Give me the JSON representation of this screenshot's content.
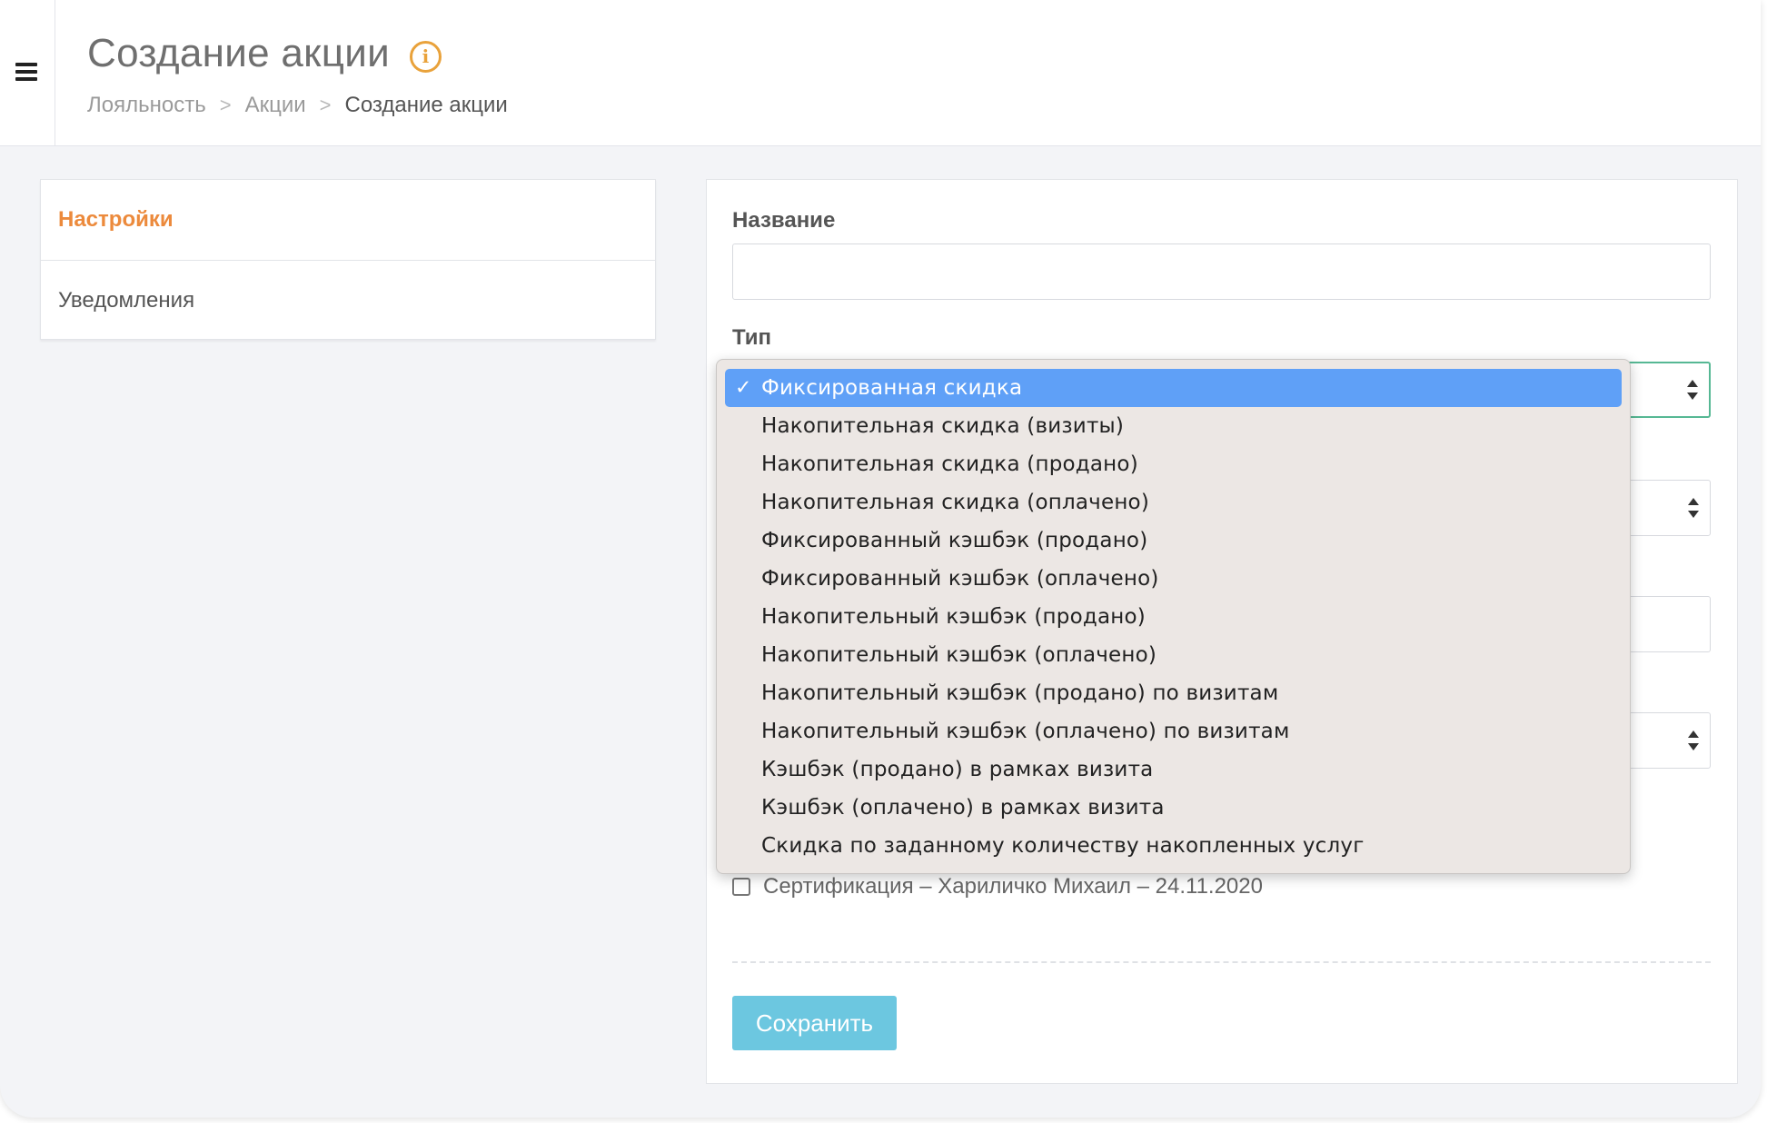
{
  "header": {
    "title": "Создание акции",
    "breadcrumb": [
      "Лояльность",
      "Акции",
      "Создание акции"
    ],
    "separator": ">"
  },
  "tabs": [
    {
      "label": "Настройки",
      "active": true
    },
    {
      "label": "Уведомления",
      "active": false
    }
  ],
  "form": {
    "name_label": "Название",
    "name_value": "",
    "type_label": "Тип",
    "certification_label": "Сертификация – Хариличко Михаил – 24.11.2020",
    "certification_checked": false,
    "save_label": "Сохранить"
  },
  "dropdown": {
    "check_glyph": "✓",
    "options": [
      {
        "label": "Фиксированная скидка",
        "selected": true
      },
      {
        "label": "Накопительная скидка (визиты)"
      },
      {
        "label": "Накопительная скидка (продано)"
      },
      {
        "label": "Накопительная скидка (оплачено)"
      },
      {
        "label": "Фиксированный кэшбэк (продано)"
      },
      {
        "label": "Фиксированный кэшбэк (оплачено)"
      },
      {
        "label": "Накопительный кэшбэк (продано)"
      },
      {
        "label": "Накопительный кэшбэк (оплачено)"
      },
      {
        "label": "Накопительный кэшбэк (продано) по визитам"
      },
      {
        "label": "Накопительный кэшбэк (оплачено) по визитам"
      },
      {
        "label": "Кэшбэк (продано) в рамках визита"
      },
      {
        "label": "Кэшбэк (оплачено) в рамках визита"
      },
      {
        "label": "Скидка по заданному количеству накопленных услуг"
      }
    ]
  },
  "colors": {
    "accent_orange": "#ec8a3c",
    "info_icon": "#e9a23b",
    "selected_option": "#5fa0f7",
    "save_button": "#6cc7e0",
    "focus_border": "#56b894"
  }
}
